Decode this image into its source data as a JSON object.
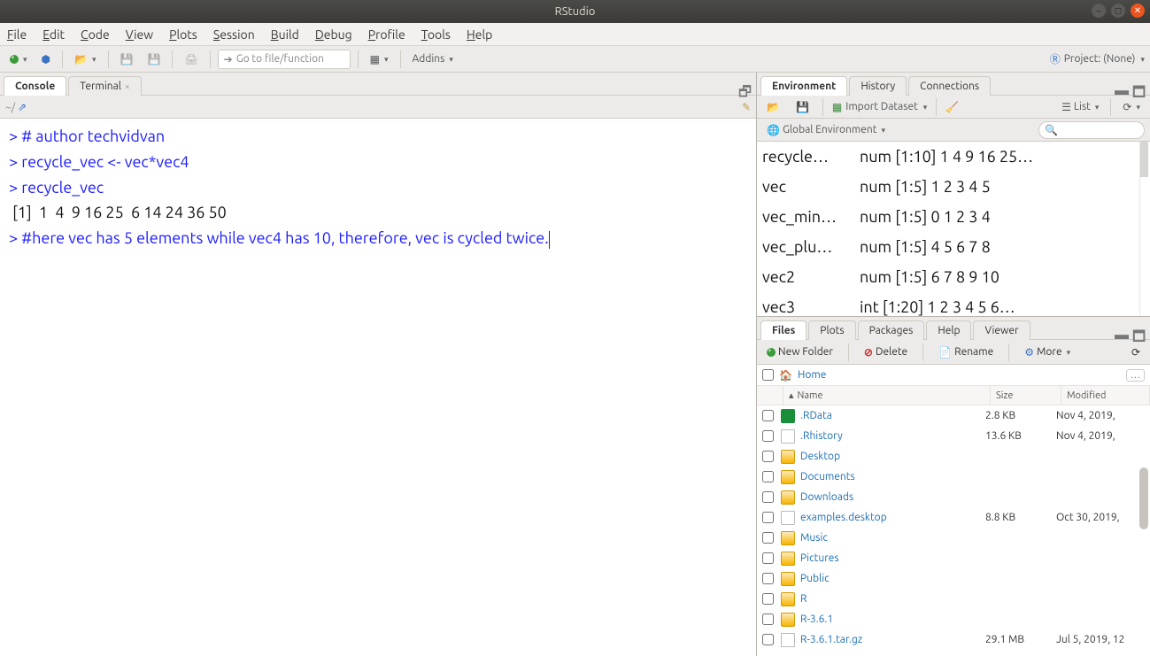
{
  "window": {
    "title": "RStudio"
  },
  "menu": [
    "File",
    "Edit",
    "Code",
    "View",
    "Plots",
    "Session",
    "Build",
    "Debug",
    "Profile",
    "Tools",
    "Help"
  ],
  "toolbar": {
    "goto_placeholder": "Go to file/function",
    "addins": "Addins",
    "project": "Project: (None)"
  },
  "left_tabs": {
    "console": "Console",
    "terminal": "Terminal",
    "path": "~/"
  },
  "console_lines": [
    {
      "p": "> ",
      "t": "# author techvidvan",
      "c": "input"
    },
    {
      "p": "> ",
      "t": "recycle_vec <- vec*vec4",
      "c": "input"
    },
    {
      "p": "> ",
      "t": "recycle_vec",
      "c": "input"
    },
    {
      "p": "",
      "t": " [1]  1  4  9 16 25  6 14 24 36 50",
      "c": "output"
    },
    {
      "p": "> ",
      "t": "#here vec has 5 elements while vec4 has 10, therefore, vec is cycled twice.",
      "c": "input"
    }
  ],
  "env_tabs": [
    "Environment",
    "History",
    "Connections"
  ],
  "env_toolbar": {
    "import": "Import Dataset",
    "list": "List",
    "scope": "Global Environment"
  },
  "env_vars": [
    {
      "name": "recycle…",
      "value": "num [1:10] 1 4 9 16 25…"
    },
    {
      "name": "vec",
      "value": "num [1:5] 1 2 3 4 5"
    },
    {
      "name": "vec_min…",
      "value": "num [1:5] 0 1 2 3 4"
    },
    {
      "name": "vec_plu…",
      "value": "num [1:5] 4 5 6 7 8"
    },
    {
      "name": "vec2",
      "value": "num [1:5] 6 7 8 9 10"
    },
    {
      "name": "vec3",
      "value": "int [1:20] 1 2 3 4 5 6…"
    }
  ],
  "files_tabs": [
    "Files",
    "Plots",
    "Packages",
    "Help",
    "Viewer"
  ],
  "files_toolbar": {
    "newfolder": "New Folder",
    "delete": "Delete",
    "rename": "Rename",
    "more": "More"
  },
  "breadcrumb": "Home",
  "file_cols": {
    "name": "Name",
    "size": "Size",
    "mod": "Modified"
  },
  "files": [
    {
      "icon": "rdata",
      "name": ".RData",
      "size": "2.8 KB",
      "mod": "Nov 4, 2019,"
    },
    {
      "icon": "file",
      "name": ".Rhistory",
      "size": "13.6 KB",
      "mod": "Nov 4, 2019,"
    },
    {
      "icon": "folder",
      "name": "Desktop",
      "size": "",
      "mod": ""
    },
    {
      "icon": "folder",
      "name": "Documents",
      "size": "",
      "mod": ""
    },
    {
      "icon": "folder",
      "name": "Downloads",
      "size": "",
      "mod": ""
    },
    {
      "icon": "file",
      "name": "examples.desktop",
      "size": "8.8 KB",
      "mod": "Oct 30, 2019,"
    },
    {
      "icon": "folder",
      "name": "Music",
      "size": "",
      "mod": ""
    },
    {
      "icon": "folder",
      "name": "Pictures",
      "size": "",
      "mod": ""
    },
    {
      "icon": "pub",
      "name": "Public",
      "size": "",
      "mod": ""
    },
    {
      "icon": "folder",
      "name": "R",
      "size": "",
      "mod": ""
    },
    {
      "icon": "folder",
      "name": "R-3.6.1",
      "size": "",
      "mod": ""
    },
    {
      "icon": "file",
      "name": "R-3.6.1.tar.gz",
      "size": "29.1 MB",
      "mod": "Jul 5, 2019, 12"
    }
  ]
}
